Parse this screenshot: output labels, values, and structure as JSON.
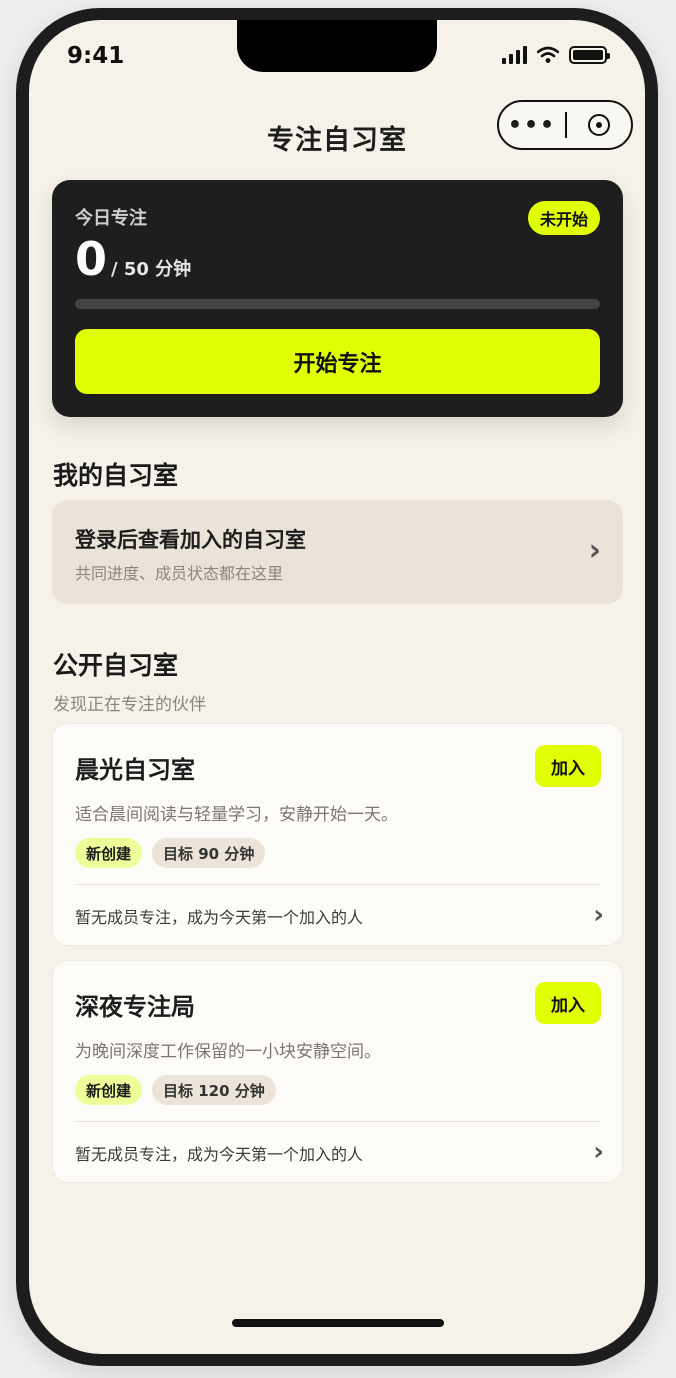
{
  "status_bar": {
    "time": "9:41"
  },
  "nav": {
    "title": "专注自习室",
    "more_icon": "•••"
  },
  "today": {
    "label": "今日专注",
    "badge": "未开始",
    "current": "0",
    "goal_text": "/ 50 分钟",
    "progress": 0,
    "start_label": "开始专注",
    "accent": "#e0ff04"
  },
  "my_rooms": {
    "title": "我的自习室",
    "login_title": "登录后查看加入的自习室",
    "login_sub": "共同进度、成员状态都在这里"
  },
  "public_rooms": {
    "title": "公开自习室",
    "subtitle": "发现正在专注的伙伴",
    "rooms": [
      {
        "name": "晨光自习室",
        "join_label": "加入",
        "description": "适合晨间阅读与轻量学习，安静开始一天。",
        "tag_new": "新创建",
        "tag_goal": "目标 90 分钟",
        "status": "暂无成员专注，成为今天第一个加入的人"
      },
      {
        "name": "深夜专注局",
        "join_label": "加入",
        "description": "为晚间深度工作保留的一小块安静空间。",
        "tag_new": "新创建",
        "tag_goal": "目标 120 分钟",
        "status": "暂无成员专注，成为今天第一个加入的人"
      }
    ]
  }
}
